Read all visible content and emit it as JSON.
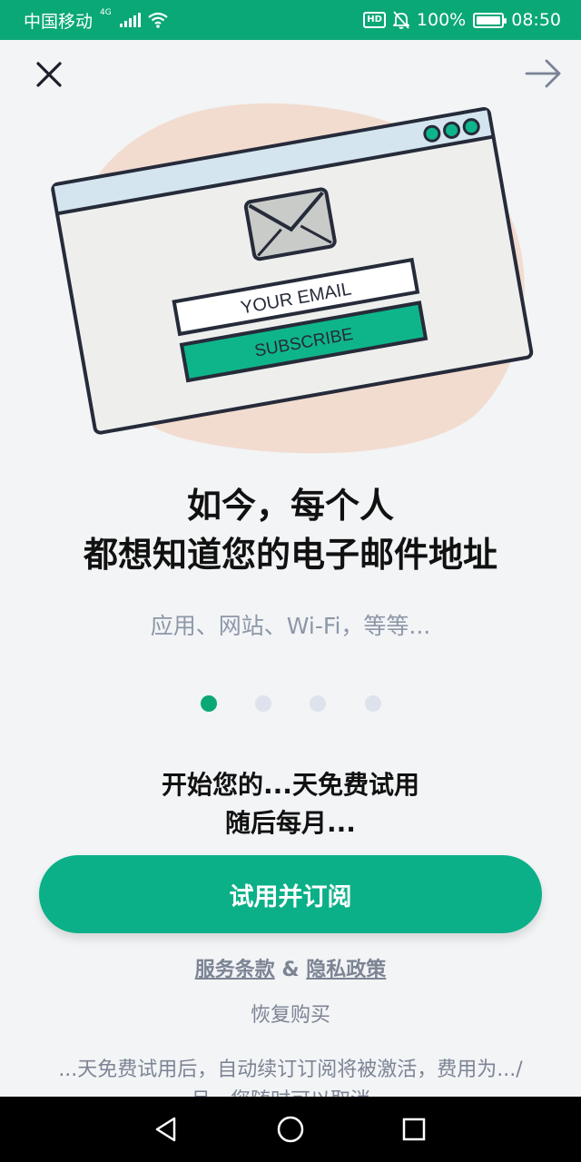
{
  "status_bar": {
    "carrier": "中国移动",
    "network": "4G",
    "hd": "HD",
    "battery": "100%",
    "battery_level": 1.0,
    "time": "08:50",
    "icons": [
      "signal-icon",
      "wifi-icon",
      "mute-icon",
      "battery-icon"
    ]
  },
  "toolbar": {
    "close_icon": "close-icon",
    "next_icon": "arrow-right-icon"
  },
  "illustration": {
    "email_placeholder": "YOUR EMAIL",
    "subscribe_label": "SUBSCRIBE",
    "icon": "envelope-icon"
  },
  "headline": {
    "line1": "如今，每个人",
    "line2": "都想知道您的电子邮件地址"
  },
  "subheadline": "应用、网站、Wi-Fi，等等...",
  "pager": {
    "count": 4,
    "active": 0
  },
  "offer": {
    "line1": "开始您的...天免费试用",
    "line2": "随后每月..."
  },
  "cta_label": "试用并订阅",
  "legal": {
    "terms": "服务条款",
    "separator": " & ",
    "privacy": "隐私政策"
  },
  "restore_label": "恢复购买",
  "disclaimer": "...天免费试用后，自动续订订阅将被激活，费用为.../月。您随时可以取消。",
  "colors": {
    "accent": "#0aa876",
    "cta": "#0bb088",
    "muted_text": "#8d97a7",
    "background": "#f2f4f6"
  }
}
